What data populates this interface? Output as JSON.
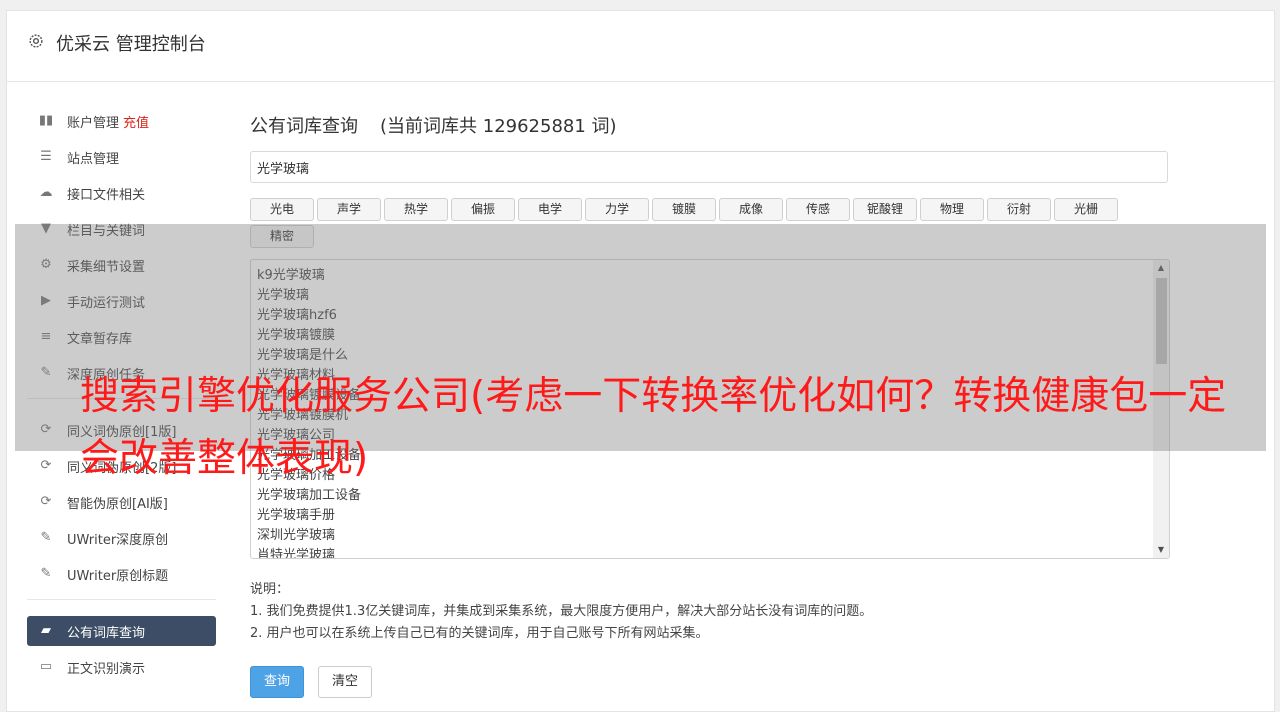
{
  "header": {
    "title": "优采云 管理控制台",
    "icon": "gear-icon"
  },
  "sidebar": {
    "items": [
      {
        "label": "账户管理",
        "extra": "充值",
        "icon": "bar-chart-icon"
      },
      {
        "label": "站点管理",
        "icon": "server-icon"
      },
      {
        "label": "接口文件相关",
        "icon": "cloud-upload-icon"
      },
      {
        "label": "栏目与关键词",
        "icon": "filter-icon"
      },
      {
        "label": "采集细节设置",
        "icon": "cogs-icon"
      },
      {
        "label": "手动运行测试",
        "icon": "play-circle-icon"
      },
      {
        "label": "文章暂存库",
        "icon": "database-icon"
      },
      {
        "label": "深度原创任务",
        "icon": "edit-icon"
      },
      {
        "label": "同义词伪原创[1版]",
        "icon": "refresh-icon"
      },
      {
        "label": "同义词伪原创[2版]",
        "icon": "refresh-icon"
      },
      {
        "label": "智能伪原创[AI版]",
        "icon": "refresh-icon"
      },
      {
        "label": "UWriter深度原创",
        "icon": "edit-icon"
      },
      {
        "label": "UWriter原创标题",
        "icon": "edit-icon"
      },
      {
        "label": "公有词库查询",
        "icon": "book-icon",
        "active": true
      },
      {
        "label": "正文识别演示",
        "icon": "monitor-icon"
      }
    ]
  },
  "main": {
    "title": "公有词库查询",
    "count_text": "(当前词库共 129625881 词)",
    "search": {
      "value": "光学玻璃",
      "placeholder": ""
    },
    "tags": [
      "光电",
      "声学",
      "热学",
      "偏振",
      "电学",
      "力学",
      "镀膜",
      "成像",
      "传感",
      "铌酸锂",
      "物理",
      "衍射",
      "光栅",
      "精密"
    ],
    "results": [
      "k9光学玻璃",
      "光学玻璃",
      "光学玻璃hzf6",
      "光学玻璃镀膜",
      "光学玻璃是什么",
      "光学玻璃材料",
      "光学玻璃镀膜设备",
      "光学玻璃镀膜机",
      "光学玻璃公司",
      "光学玻璃加工设备",
      "光学玻璃价格",
      "光学玻璃加工设备",
      "光学玻璃手册",
      "深圳光学玻璃",
      "肖特光学玻璃"
    ],
    "notes": {
      "heading": "说明：",
      "lines": [
        "1. 我们免费提供1.3亿关键词库，并集成到采集系统，最大限度方便用户，解决大部分站长没有词库的问题。",
        "2. 用户也可以在系统上传自己已有的关键词库，用于自己账号下所有网站采集。"
      ]
    },
    "buttons": {
      "query": "查询",
      "clear": "清空"
    }
  },
  "overlay": {
    "banner": "搜索引擎优化服务公司(考虑一下转换率优化如何？转换健康包一定会改善整体表现)"
  },
  "colors": {
    "accent": "#3d4d66",
    "primary": "#4ea3e6",
    "highlight": "#d9241b",
    "banner": "#ff1a1a"
  }
}
